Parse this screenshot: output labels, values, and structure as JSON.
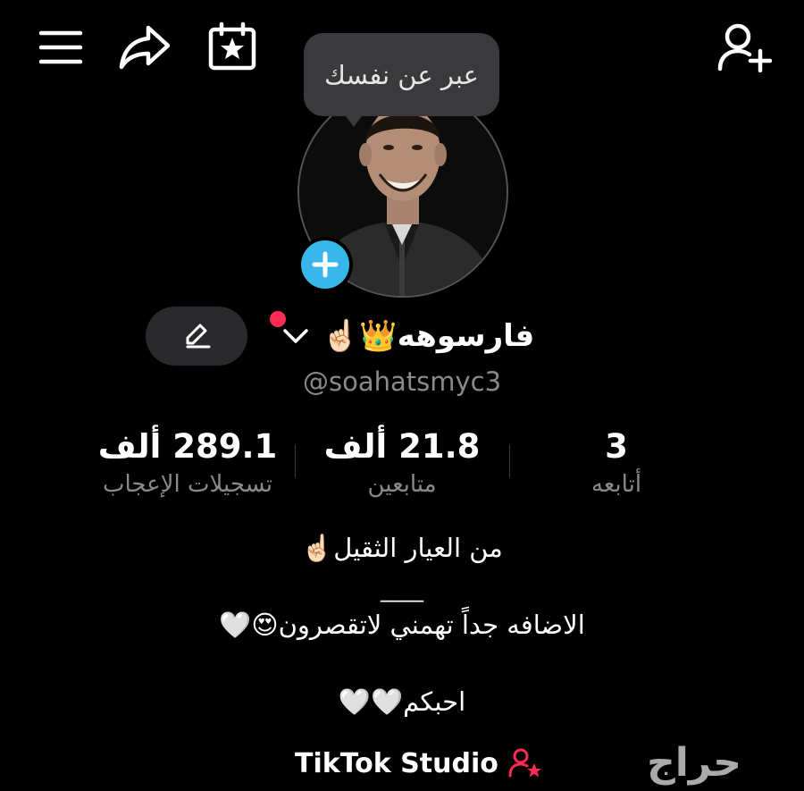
{
  "toolbar": {
    "menu_icon": "menu-icon",
    "share_icon": "share-icon",
    "calendar_icon": "calendar-star-icon",
    "add_friend_icon": "add-user-icon"
  },
  "tooltip": {
    "text": "عبر عن نفسك"
  },
  "profile": {
    "display_name": "فارسوهه👑☝🏻",
    "username": "@soahatsmyc3",
    "accent_color": "#38b7ea",
    "notification_color": "#fe2c55"
  },
  "stats": {
    "likes": {
      "value": "289.1 ألف",
      "label": "تسجيلات الإعجاب"
    },
    "followers": {
      "value": "21.8 ألف",
      "label": "متابعين"
    },
    "following": {
      "value": "3",
      "label": "أتابعه"
    }
  },
  "bio": {
    "line1": "من العيار الثقيل☝🏻",
    "line2": "____",
    "line3": "الاضافه جداً تهمني لاتقصرون😍🤍",
    "line4": "احبكم🤍🤍"
  },
  "studio": {
    "label": "TikTok Studio",
    "icon": "creator-star-icon"
  },
  "watermark": {
    "text": "حراج"
  }
}
